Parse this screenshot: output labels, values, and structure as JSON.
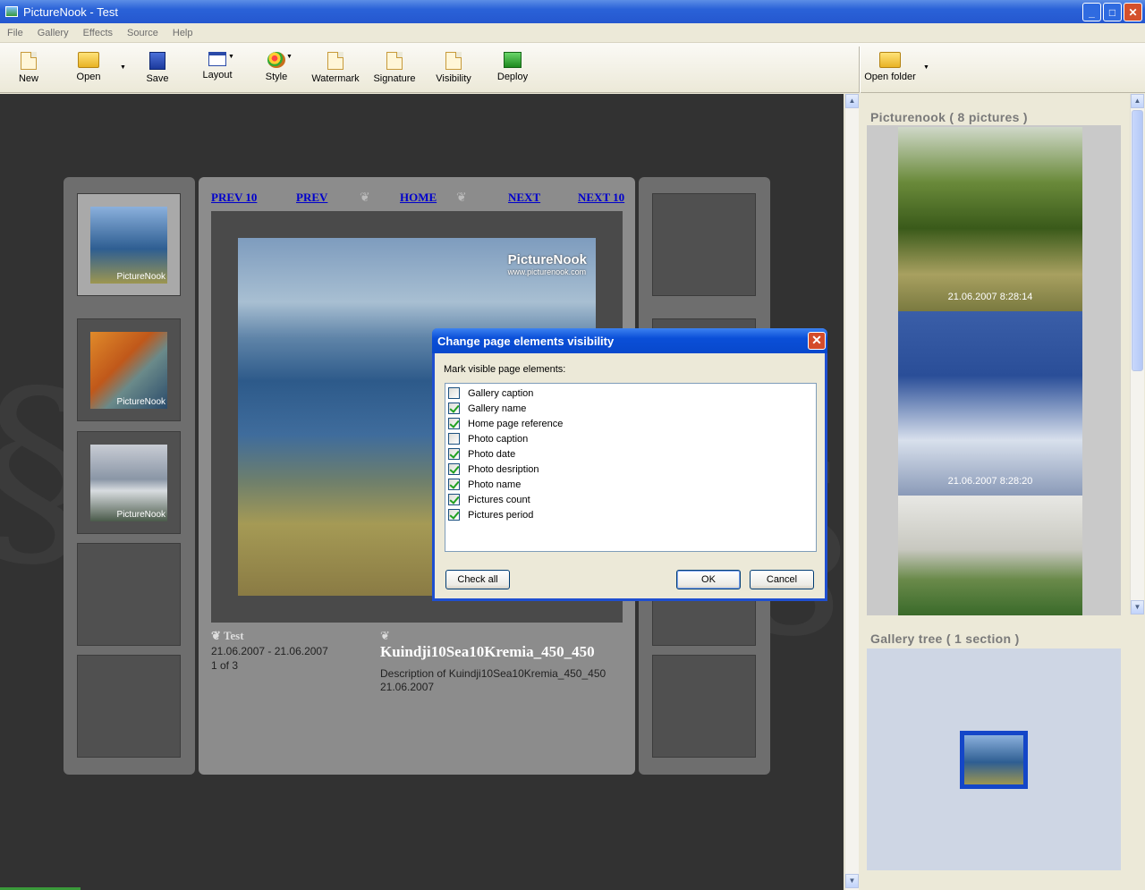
{
  "window": {
    "title": "PictureNook - Test"
  },
  "menu": [
    "File",
    "Gallery",
    "Effects",
    "Source",
    "Help"
  ],
  "toolbar": {
    "new": "New",
    "open": "Open",
    "save": "Save",
    "layout": "Layout",
    "style": "Style",
    "watermark": "Watermark",
    "signature": "Signature",
    "visibility": "Visibility",
    "deploy": "Deploy",
    "open_folder": "Open folder"
  },
  "preview": {
    "nav": {
      "prev10": "PREV 10",
      "prev": "PREV",
      "home": "HOME",
      "next": "NEXT",
      "next10": "NEXT 10"
    },
    "watermark": {
      "name": "PictureNook",
      "url": "www.picturenook.com"
    },
    "thumb_watermark": "PictureNook",
    "gallery": {
      "name": "Test",
      "period": "21.06.2007 - 21.06.2007",
      "count": "1 of 3"
    },
    "photo": {
      "name": "Kuindji10Sea10Kremia_450_450",
      "description": "Description of Kuindji10Sea10Kremia_450_450",
      "date": "21.06.2007"
    }
  },
  "side": {
    "pictures_header": "Picturenook ( 8 pictures )",
    "thumbs": [
      {
        "date": "21.06.2007 8:28:14"
      },
      {
        "date": "21.06.2007 8:28:20"
      },
      {
        "date": ""
      }
    ],
    "tree_header": "Gallery tree ( 1 section )"
  },
  "dialog": {
    "title": "Change page elements visibility",
    "label": "Mark visible page elements:",
    "items": [
      {
        "label": "Gallery caption",
        "checked": false
      },
      {
        "label": "Gallery name",
        "checked": true
      },
      {
        "label": "Home page reference",
        "checked": true
      },
      {
        "label": "Photo caption",
        "checked": false
      },
      {
        "label": "Photo date",
        "checked": true
      },
      {
        "label": "Photo desription",
        "checked": true
      },
      {
        "label": "Photo name",
        "checked": true
      },
      {
        "label": "Pictures count",
        "checked": true
      },
      {
        "label": "Pictures period",
        "checked": true
      }
    ],
    "check_all": "Check all",
    "ok": "OK",
    "cancel": "Cancel"
  }
}
